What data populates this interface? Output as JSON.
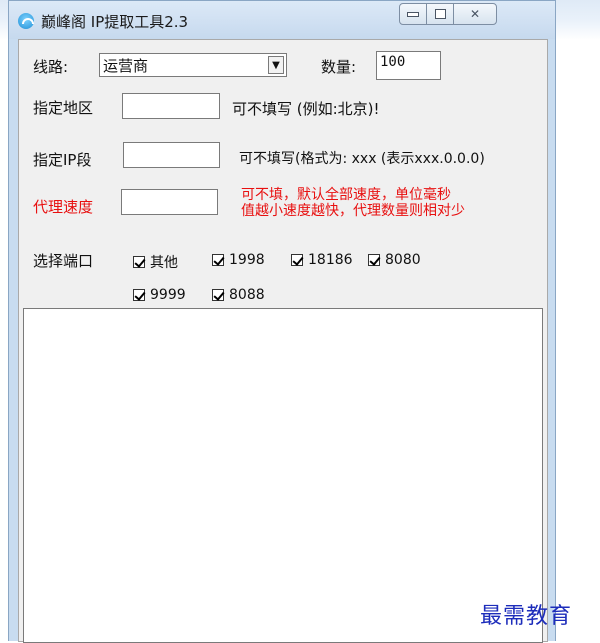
{
  "window": {
    "title": "巅峰阁 IP提取工具2.3",
    "controls": {
      "close_glyph": "✕"
    }
  },
  "form": {
    "route": {
      "label": "线路:",
      "selected": "运营商"
    },
    "quantity": {
      "label": "数量:",
      "value": "100"
    },
    "region": {
      "label": "指定地区",
      "value": "",
      "hint": "可不填写 (例如:北京)!"
    },
    "ip_segment": {
      "label": "指定IP段",
      "value": "",
      "hint": "可不填写(格式为: xxx (表示xxx.0.0.0)"
    },
    "proxy_speed": {
      "label": "代理速度",
      "value": "",
      "hint_line1": "可不填，默认全部速度，单位毫秒",
      "hint_line2": "值越小速度越快，代理数量则相对少"
    },
    "ports": {
      "label": "选择端口",
      "options": [
        {
          "label": "其他",
          "checked": true
        },
        {
          "label": "1998",
          "checked": true
        },
        {
          "label": "18186",
          "checked": true
        },
        {
          "label": "8080",
          "checked": true
        },
        {
          "label": "9999",
          "checked": true
        },
        {
          "label": "8088",
          "checked": true
        }
      ]
    }
  },
  "output": {
    "text": ""
  },
  "watermark": "最需教育",
  "colors": {
    "warning_red": "#e81010",
    "watermark_blue": "#1d2dbb"
  }
}
